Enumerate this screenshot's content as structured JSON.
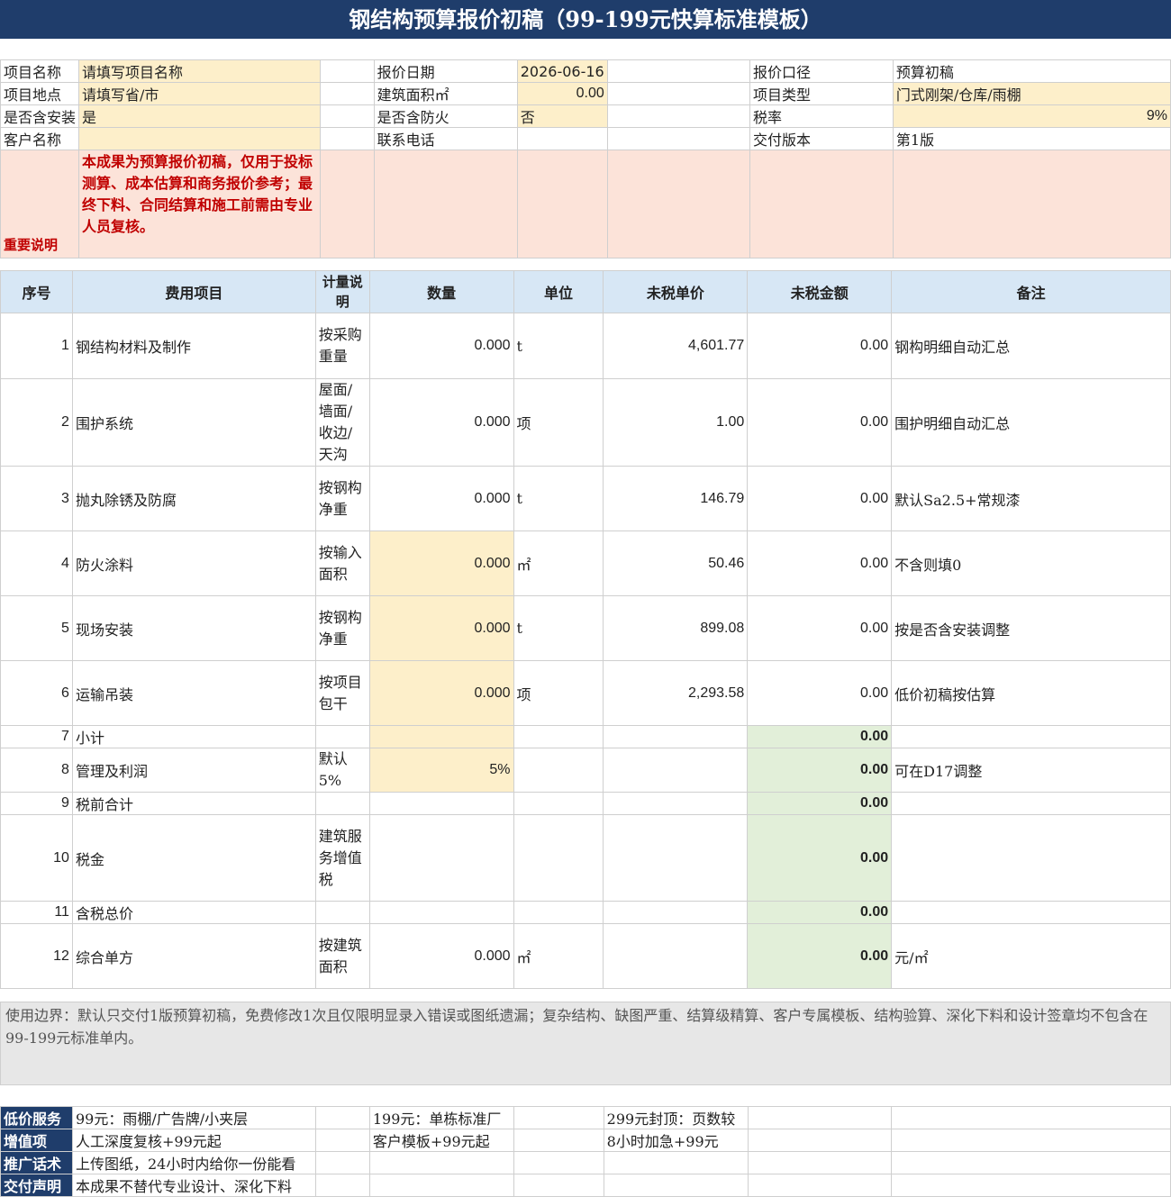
{
  "title": "钢结构预算报价初稿（99-199元快算标准模板）",
  "info": {
    "project_name_label": "项目名称",
    "project_name_value": "请填写项目名称",
    "quote_date_label": "报价日期",
    "quote_date_value": "2026-06-16",
    "quote_basis_label": "报价口径",
    "quote_basis_value": "预算初稿",
    "location_label": "项目地点",
    "location_value": "请填写省/市",
    "area_label": "建筑面积㎡",
    "area_value": "0.00",
    "type_label": "项目类型",
    "type_value": "门式刚架/仓库/雨棚",
    "install_label": "是否含安装",
    "install_value": "是",
    "fire_label": "是否含防火",
    "fire_value": "否",
    "tax_label": "税率",
    "tax_value": "9%",
    "client_label": "客户名称",
    "client_value": "",
    "phone_label": "联系电话",
    "phone_value": "",
    "version_label": "交付版本",
    "version_value": "第1版",
    "important_label": "重要说明",
    "important_text": "本成果为预算报价初稿，仅用于投标测算、成本估算和商务报价参考；最终下料、合同结算和施工前需由专业人员复核。"
  },
  "table": {
    "headers": [
      "序号",
      "费用项目",
      "计量说明",
      "数量",
      "单位",
      "未税单价",
      "未税金额",
      "备注"
    ],
    "rows": [
      {
        "no": "1",
        "item": "钢结构材料及制作",
        "basis": "按采购重量",
        "qty": "0.000",
        "unit": "t",
        "price": "4,601.77",
        "amount": "0.00",
        "remark": "钢构明细自动汇总"
      },
      {
        "no": "2",
        "item": "围护系统",
        "basis": "屋面/墙面/收边/天沟",
        "qty": "0.000",
        "unit": "项",
        "price": "1.00",
        "amount": "0.00",
        "remark": "围护明细自动汇总"
      },
      {
        "no": "3",
        "item": "抛丸除锈及防腐",
        "basis": "按钢构净重",
        "qty": "0.000",
        "unit": "t",
        "price": "146.79",
        "amount": "0.00",
        "remark": "默认Sa2.5+常规漆"
      },
      {
        "no": "4",
        "item": "防火涂料",
        "basis": "按输入面积",
        "qty": "0.000",
        "unit": "㎡",
        "price": "50.46",
        "amount": "0.00",
        "remark": "不含则填0"
      },
      {
        "no": "5",
        "item": "现场安装",
        "basis": "按钢构净重",
        "qty": "0.000",
        "unit": "t",
        "price": "899.08",
        "amount": "0.00",
        "remark": "按是否含安装调整"
      },
      {
        "no": "6",
        "item": "运输吊装",
        "basis": "按项目包干",
        "qty": "0.000",
        "unit": "项",
        "price": "2,293.58",
        "amount": "0.00",
        "remark": "低价初稿按估算"
      },
      {
        "no": "7",
        "item": "小计",
        "basis": "",
        "qty": "",
        "unit": "",
        "price": "",
        "amount": "0.00",
        "remark": ""
      },
      {
        "no": "8",
        "item": "管理及利润",
        "basis": "默认5%",
        "qty": "5%",
        "unit": "",
        "price": "",
        "amount": "0.00",
        "remark": "可在D17调整"
      },
      {
        "no": "9",
        "item": "税前合计",
        "basis": "",
        "qty": "",
        "unit": "",
        "price": "",
        "amount": "0.00",
        "remark": ""
      },
      {
        "no": "10",
        "item": "税金",
        "basis": "建筑服务增值税",
        "qty": "",
        "unit": "",
        "price": "",
        "amount": "0.00",
        "remark": ""
      },
      {
        "no": "11",
        "item": "含税总价",
        "basis": "",
        "qty": "",
        "unit": "",
        "price": "",
        "amount": "0.00",
        "remark": ""
      },
      {
        "no": "12",
        "item": "综合单方",
        "basis": "按建筑面积",
        "qty": "0.000",
        "unit": "㎡",
        "price": "",
        "amount": "0.00",
        "remark": "元/㎡"
      }
    ]
  },
  "usage_note": "使用边界：默认只交付1版预算初稿，免费修改1次且仅限明显录入错误或图纸遗漏；复杂结构、缺图严重、结算级精算、客户专属模板、结构验算、深化下料和设计签章均不包含在99-199元标准单内。",
  "footer": [
    {
      "label": "低价服务",
      "c1": "99元：雨棚/广告牌/小夹层",
      "c2": "199元：单栋标准厂",
      "c3": "299元封顶：页数较"
    },
    {
      "label": "增值项",
      "c1": "人工深度复核+99元起",
      "c2": "客户模板+99元起",
      "c3": "8小时加急+99元"
    },
    {
      "label": "推广话术",
      "c1": "上传图纸，24小时内给你一份能看",
      "c2": "",
      "c3": ""
    },
    {
      "label": "交付声明",
      "c1": "本成果不替代专业设计、深化下料",
      "c2": "",
      "c3": ""
    }
  ]
}
